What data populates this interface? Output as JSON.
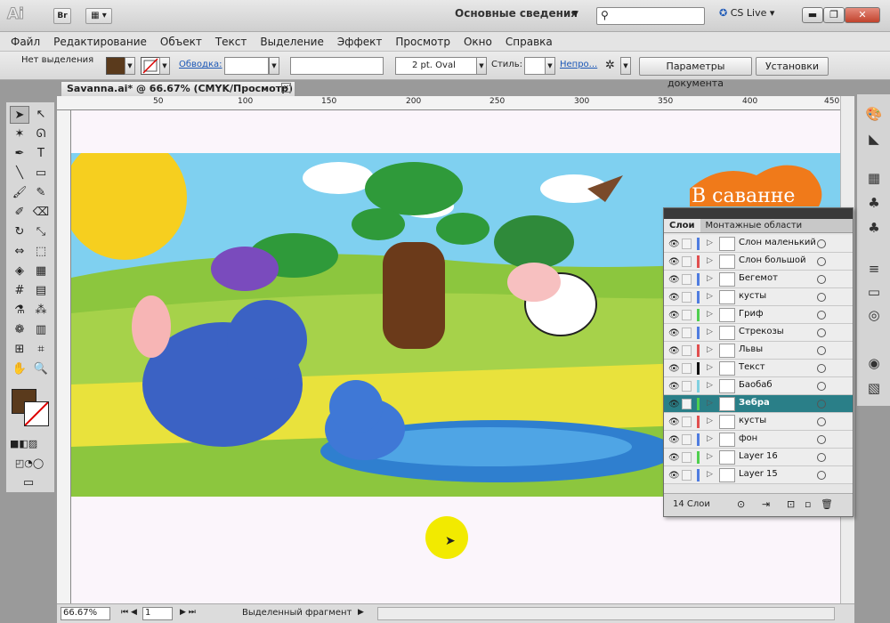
{
  "app": {
    "logo": "Ai",
    "br_label": "Br",
    "workspace": "Основные сведения",
    "cs_live": "CS Live"
  },
  "menu": [
    "Файл",
    "Редактирование",
    "Объект",
    "Текст",
    "Выделение",
    "Эффект",
    "Просмотр",
    "Окно",
    "Справка"
  ],
  "control": {
    "selection": "Нет выделения",
    "stroke_label": "Обводка:",
    "brush": "2 pt. Oval",
    "style_label": "Стиль:",
    "opacity_link": "Непро...",
    "doc_params": "Параметры документа",
    "settings": "Установки"
  },
  "document": {
    "tab": "Savanna.ai* @ 66.67% (CMYK/Просмотр)",
    "artwork_title": "В саванне"
  },
  "ruler": {
    "top": [
      "50",
      "100",
      "150",
      "200",
      "250",
      "300",
      "350",
      "400",
      "450"
    ]
  },
  "status": {
    "zoom": "66.67%",
    "page": "1",
    "info": "Выделенный фрагмент"
  },
  "layers": {
    "tab_layers": "Слои",
    "tab_artboards": "Монтажные области",
    "footer": "14 Слои",
    "items": [
      {
        "name": "Слон маленький",
        "color": "#4f7ce0"
      },
      {
        "name": "Слон большой",
        "color": "#e04f4f"
      },
      {
        "name": "Бегемот",
        "color": "#4f7ce0"
      },
      {
        "name": "кусты",
        "color": "#4f7ce0"
      },
      {
        "name": "Гриф",
        "color": "#4fcf4f"
      },
      {
        "name": "Стрекозы",
        "color": "#4f7ce0"
      },
      {
        "name": "Львы",
        "color": "#e04f4f"
      },
      {
        "name": "Текст",
        "color": "#111111"
      },
      {
        "name": "Баобаб",
        "color": "#7fd0e0"
      },
      {
        "name": "Зебра",
        "color": "#4fcf4f",
        "selected": true
      },
      {
        "name": "кусты",
        "color": "#e04f4f"
      },
      {
        "name": "фон",
        "color": "#4f7ce0"
      },
      {
        "name": "Layer 16",
        "color": "#4fcf4f"
      },
      {
        "name": "Layer 15",
        "color": "#4f7ce0"
      }
    ]
  },
  "colors": {
    "fill": "#5a3a1c",
    "accent": "#2a7f88",
    "highlight": "#f2ea00"
  }
}
